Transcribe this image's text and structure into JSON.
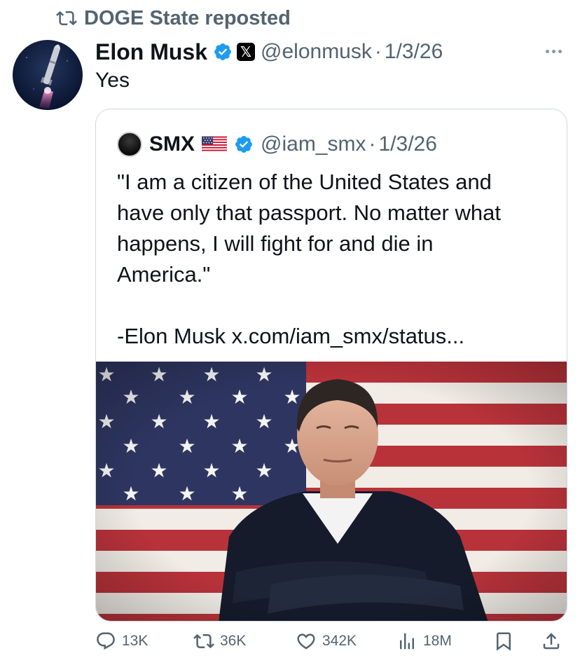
{
  "repost": {
    "icon": "repost-icon",
    "text": "DOGE State reposted"
  },
  "post": {
    "author_name": "Elon Musk",
    "handle": "@elonmusk",
    "separator": "·",
    "date": "1/3/26",
    "text": "Yes",
    "avatar_icon": "rocket-avatar"
  },
  "quote": {
    "author_name": "SMX",
    "flag_icon": "us-flag-emoji",
    "handle": "@iam_smx",
    "separator": "·",
    "date": "1/3/26",
    "text_lines": [
      "\"I am a citizen of the United States and",
      "have only that passport. No matter what",
      "happens, I will fight for and die in",
      "America.\""
    ],
    "signature_line": "-Elon Musk x.com/iam_smx/status..."
  },
  "actions": {
    "replies": "13K",
    "reposts": "36K",
    "likes": "342K",
    "views": "18M"
  },
  "colors": {
    "verified_blue": "#1d9bf0",
    "muted_text": "#536471",
    "border": "#cfd9de"
  }
}
